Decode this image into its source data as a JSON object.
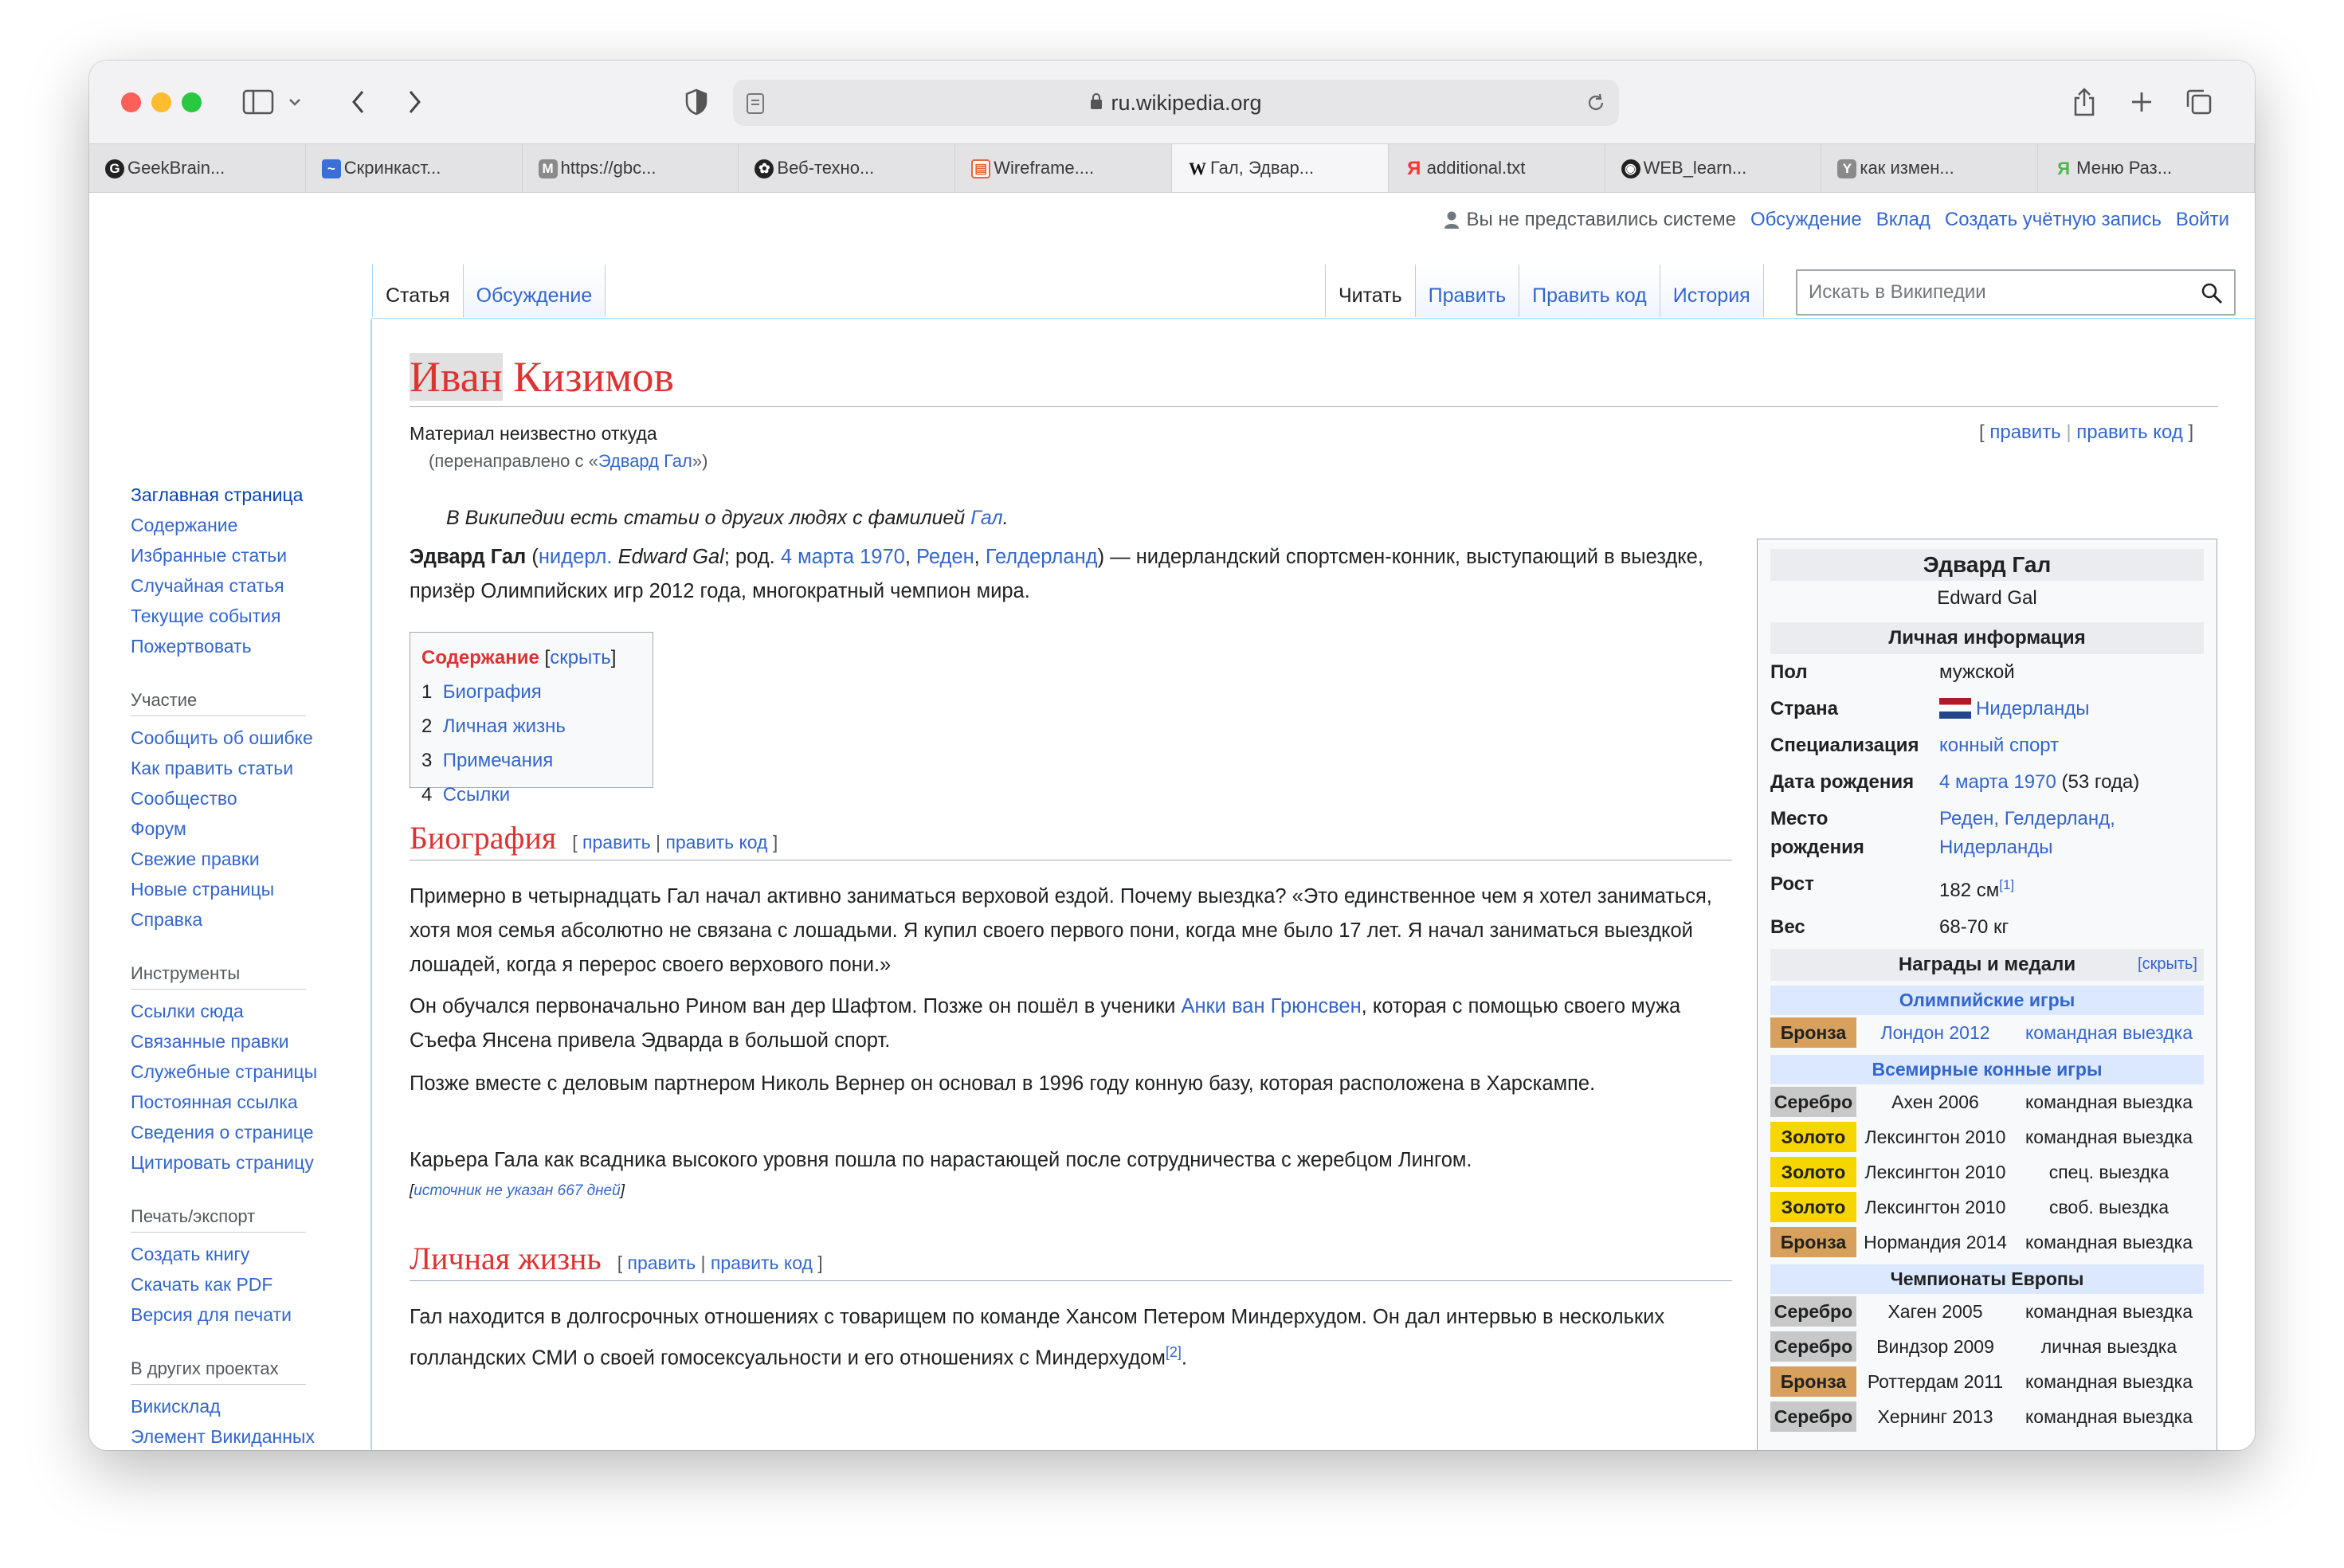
{
  "browser": {
    "url": "ru.wikipedia.org",
    "tabs": [
      {
        "label": "GeekBrain...",
        "icon": "geekbrains-icon"
      },
      {
        "label": "Скринкаст...",
        "icon": "screencast-icon"
      },
      {
        "label": "https://gbc...",
        "icon": "m-icon"
      },
      {
        "label": "Веб-техно...",
        "icon": "openai-icon"
      },
      {
        "label": "Wireframe....",
        "icon": "wireframe-icon"
      },
      {
        "label": "Гал, Эдвар...",
        "icon": "wikipedia-icon"
      },
      {
        "label": "additional.txt",
        "icon": "yandex-icon"
      },
      {
        "label": "WEB_learn...",
        "icon": "github-icon"
      },
      {
        "label": "как измен...",
        "icon": "y-icon"
      },
      {
        "label": "Меню Раз...",
        "icon": "yandex-green-icon"
      }
    ]
  },
  "personal": {
    "anon": "Вы не представились системе",
    "links": [
      "Обсуждение",
      "Вклад",
      "Создать учётную запись",
      "Войти"
    ]
  },
  "sidebar": {
    "main": [
      "Заглавная страница",
      "Содержание",
      "Избранные статьи",
      "Случайная статья",
      "Текущие события",
      "Пожертвовать"
    ],
    "sections": [
      {
        "title": "Участие",
        "items": [
          "Сообщить об ошибке",
          "Как править статьи",
          "Сообщество",
          "Форум",
          "Свежие правки",
          "Новые страницы",
          "Справка"
        ]
      },
      {
        "title": "Инструменты",
        "items": [
          "Ссылки сюда",
          "Связанные правки",
          "Служебные страницы",
          "Постоянная ссылка",
          "Сведения о странице",
          "Цитировать страницу"
        ]
      },
      {
        "title": "Печать/экспорт",
        "items": [
          "Создать книгу",
          "Скачать как PDF",
          "Версия для печати"
        ]
      },
      {
        "title": "В других проектах",
        "items": [
          "Викисклад",
          "Элемент Викиданных"
        ]
      }
    ]
  },
  "page_tabs": {
    "article": "Статья",
    "talk": "Обсуждение",
    "read": "Читать",
    "edit": "Править",
    "edit_source": "Править код",
    "history": "История"
  },
  "search": {
    "placeholder": "Искать в Википедии"
  },
  "article": {
    "title_first": "Иван",
    "title_last": " Кизимов",
    "subtitle": "Материал неизвестно откуда",
    "redirect_prefix": "(перенаправлено с «",
    "redirect_link": "Эдвард Гал",
    "redirect_suffix": "»)",
    "edit": "править",
    "edit_code": "править код",
    "hatnote_text": "В Википедии есть статьи о других людях с фамилией ",
    "hatnote_link": "Гал",
    "intro": {
      "bold": "Эдвард Гал",
      "lang": "нидерл.",
      "orig": "Edward Gal",
      "born": "; род. ",
      "date": "4 марта 1970",
      "city": "Реден",
      "region": "Гелдерланд",
      "rest": ") — нидерландский спортсмен-конник, выступающий в выездке, призёр Олимпийских игр 2012 года, многократный чемпион мира."
    },
    "toc": {
      "title": "Содержание",
      "hide": "скрыть",
      "items": [
        {
          "n": "1",
          "label": "Биография"
        },
        {
          "n": "2",
          "label": "Личная жизнь"
        },
        {
          "n": "3",
          "label": "Примечания"
        },
        {
          "n": "4",
          "label": "Ссылки"
        }
      ]
    },
    "bio_heading": "Биография",
    "bio_p1": "Примерно в четырнадцать Гал начал активно заниматься верховой ездой. Почему выездка? «Это единственное чем я хотел заниматься, хотя моя семья абсолютно не связана с лошадьми. Я купил своего первого пони, когда мне было 17 лет. Я начал заниматься выездкой лошадей, когда я перерос своего верхового пони.»",
    "bio_p2_a": "Он обучался первоначально Рином ван дер Шафтом. Позже он пошёл в ученики ",
    "bio_p2_link": "Анки ван Грюнсвен",
    "bio_p2_b": ", которая с помощью своего мужа Съефа Янсена привела Эдварда в большой спорт.",
    "bio_p3": "Позже вместе с деловым партнером Николь Вернер он основал в 1996 году конную базу, которая расположена в Харскампе.",
    "bio_p4": "Карьера Гала как всадника высокого уровня пошла по нарастающей после сотрудничества с жеребцом Лингом.",
    "cite_needed": "источник не указан 667 дней",
    "life_heading": "Личная жизнь",
    "life_p1": "Гал находится в долгосрочных отношениях с товарищем по команде Хансом Петером Миндерхудом. Он дал интервью в нескольких голландских СМИ о своей гомосексуальности и его отношениях с Миндерхудом",
    "life_ref": "[2]"
  },
  "infobox": {
    "name": "Эдвард Гал",
    "latin": "Edward Gal",
    "personal_head": "Личная информация",
    "rows": [
      {
        "k": "Пол",
        "v": "мужской",
        "link": false
      },
      {
        "k": "Страна",
        "v": "Нидерланды",
        "link": true,
        "flag": true
      },
      {
        "k": "Специализация",
        "v": "конный спорт",
        "link": true
      },
      {
        "k": "Дата рождения",
        "v": "4 марта 1970",
        "extra": " (53 года)",
        "link": true
      },
      {
        "k": "Место рождения",
        "v": "Реден, Гелдерланд, Нидерланды",
        "link": true
      },
      {
        "k": "Рост",
        "v": "182 см",
        "sup": "[1]",
        "link": false
      },
      {
        "k": "Вес",
        "v": "68-70 кг",
        "link": false
      }
    ],
    "medals_head": "Награды и медали",
    "medals_hide": "[скрыть]",
    "competitions": [
      {
        "name": "Олимпийские игры",
        "medals": [
          {
            "m": "Бронза",
            "c": "bronze",
            "p": "Лондон 2012",
            "e": "командная выездка",
            "link": true
          }
        ]
      },
      {
        "name": "Всемирные конные игры",
        "medals": [
          {
            "m": "Серебро",
            "c": "silver",
            "p": "Ахен 2006",
            "e": "командная выездка"
          },
          {
            "m": "Золото",
            "c": "gold",
            "p": "Лексингтон 2010",
            "e": "командная выездка"
          },
          {
            "m": "Золото",
            "c": "gold",
            "p": "Лексингтон 2010",
            "e": "спец. выездка"
          },
          {
            "m": "Золото",
            "c": "gold",
            "p": "Лексингтон 2010",
            "e": "своб. выездка"
          },
          {
            "m": "Бронза",
            "c": "bronze",
            "p": "Нормандия 2014",
            "e": "командная выездка"
          }
        ]
      },
      {
        "name": "Чемпионаты Европы",
        "medals": [
          {
            "m": "Серебро",
            "c": "silver",
            "p": "Хаген 2005",
            "e": "командная выездка"
          },
          {
            "m": "Серебро",
            "c": "silver",
            "p": "Виндзор 2009",
            "e": "личная выездка"
          },
          {
            "m": "Бронза",
            "c": "bronze",
            "p": "Роттердам 2011",
            "e": "командная выездка"
          },
          {
            "m": "Серебро",
            "c": "silver",
            "p": "Хернинг 2013",
            "e": "командная выездка"
          }
        ]
      }
    ]
  }
}
